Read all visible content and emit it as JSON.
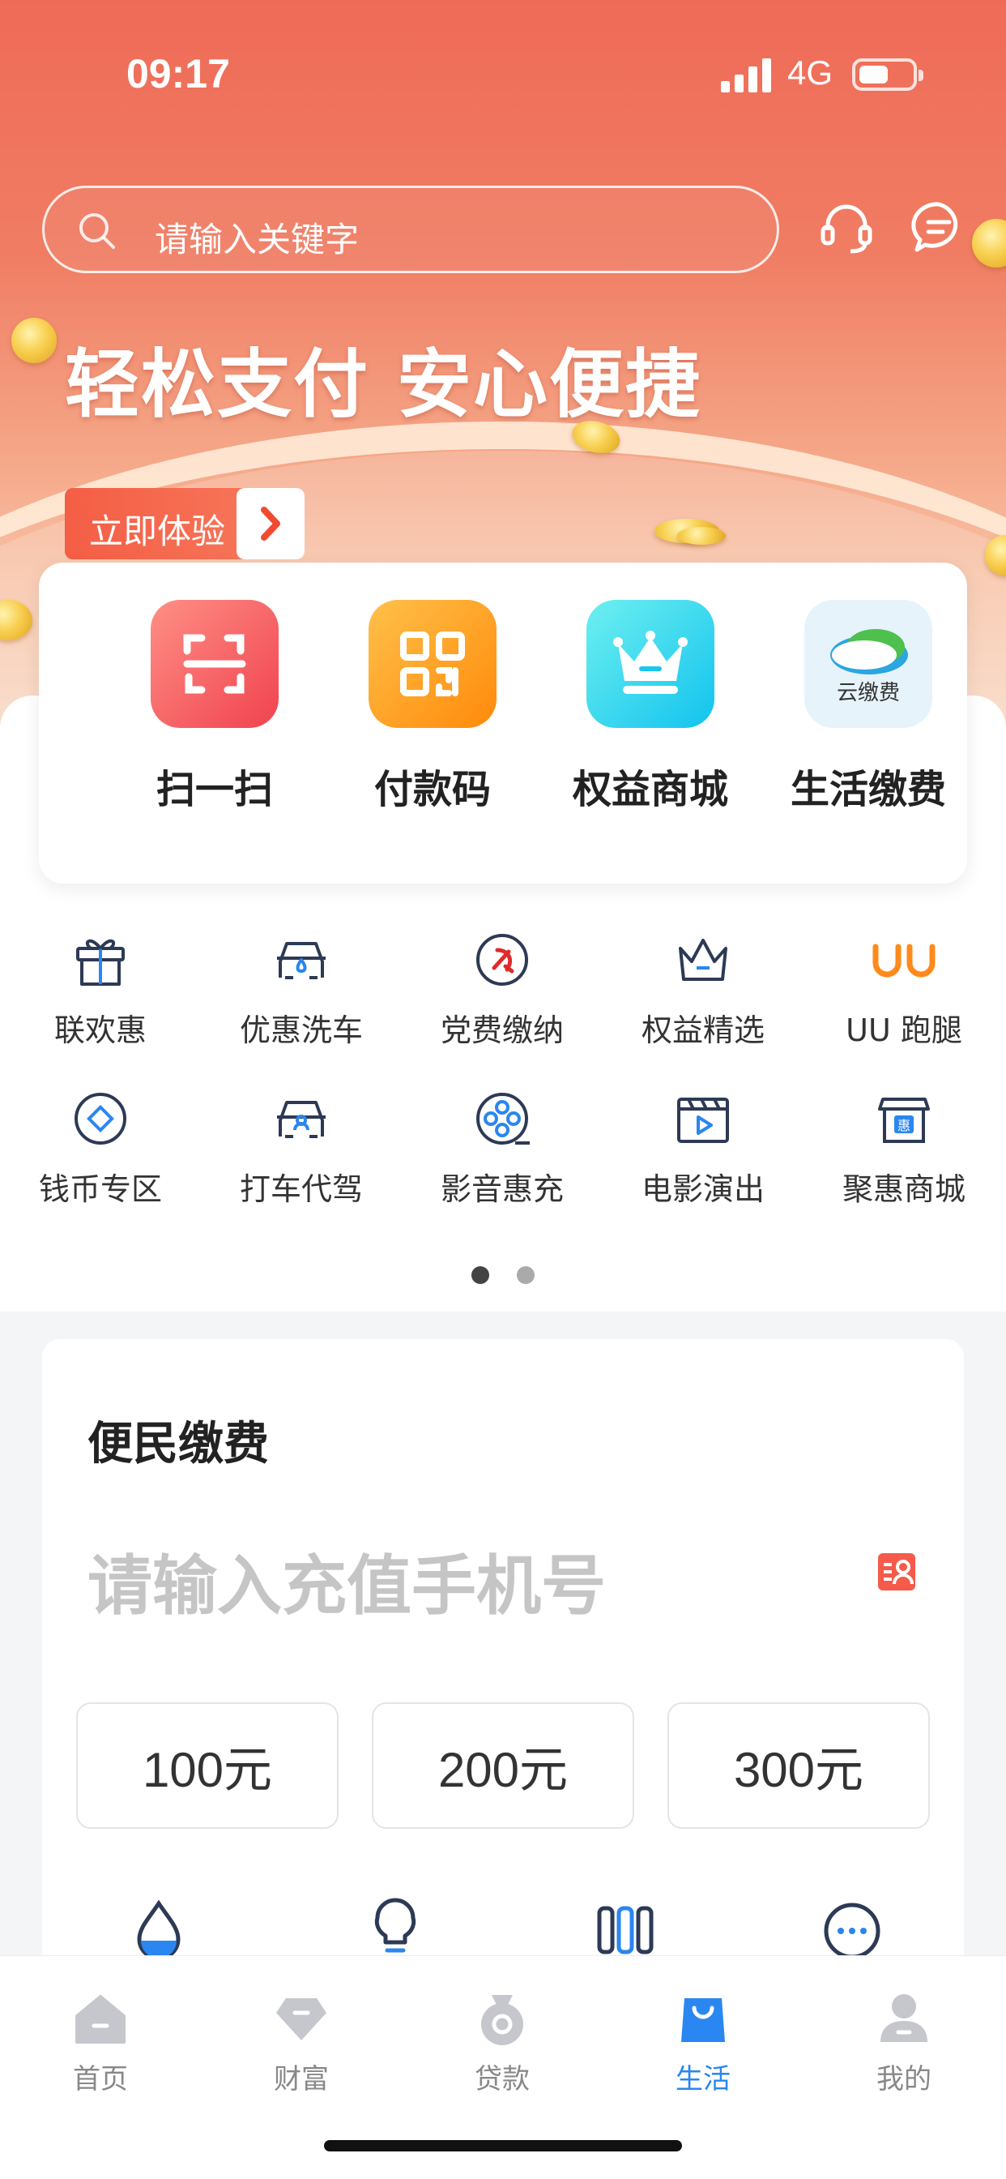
{
  "status_bar": {
    "time": "09:17",
    "network": "4G",
    "battery": 0.55
  },
  "header": {
    "search": {
      "placeholder": "请输入关键字"
    },
    "icons": [
      "headset-icon",
      "message-icon"
    ]
  },
  "banner": {
    "slogan": "轻松支付 安心便捷",
    "cta_label": "立即体验"
  },
  "quick_actions": [
    {
      "label": "扫一扫",
      "icon": "scan-icon",
      "color": "#f2555b"
    },
    {
      "label": "付款码",
      "icon": "qr-code-icon",
      "color": "#ff9a1a"
    },
    {
      "label": "权益商城",
      "icon": "crown-icon",
      "color": "#18cbe8"
    },
    {
      "label": "生活缴费",
      "icon": "cloud-pay-icon",
      "color": "#e8f4fb",
      "badge": "云缴费"
    }
  ],
  "services": [
    {
      "label": "联欢惠",
      "icon": "gift-icon"
    },
    {
      "label": "优惠洗车",
      "icon": "car-wash-icon"
    },
    {
      "label": "党费缴纳",
      "icon": "party-emblem-icon"
    },
    {
      "label": "权益精选",
      "icon": "crown-outline-icon"
    },
    {
      "label": "UU 跑腿",
      "icon": "uu-logo-icon"
    },
    {
      "label": "钱币专区",
      "icon": "coin-icon"
    },
    {
      "label": "打车代驾",
      "icon": "driver-icon"
    },
    {
      "label": "影音惠充",
      "icon": "film-reel-icon"
    },
    {
      "label": "电影演出",
      "icon": "clapperboard-icon"
    },
    {
      "label": "聚惠商城",
      "icon": "shop-icon"
    }
  ],
  "pager": {
    "pages": 2,
    "current": 1
  },
  "bill_pay": {
    "title": "便民缴费",
    "phone_placeholder": "请输入充值手机号",
    "amounts": [
      "100元",
      "200元",
      "300元"
    ],
    "icons": [
      "water-icon",
      "electricity-icon",
      "gas-icon",
      "more-icon"
    ]
  },
  "tabbar": [
    {
      "label": "首页",
      "icon": "home-icon",
      "active": false
    },
    {
      "label": "财富",
      "icon": "diamond-icon",
      "active": false
    },
    {
      "label": "贷款",
      "icon": "money-bag-icon",
      "active": false
    },
    {
      "label": "生活",
      "icon": "shopping-bag-icon",
      "active": true
    },
    {
      "label": "我的",
      "icon": "user-icon",
      "active": false
    }
  ],
  "colors": {
    "accent": "#2a86f0",
    "banner": "#ef6b57",
    "service_icon": "#2d3a55"
  }
}
